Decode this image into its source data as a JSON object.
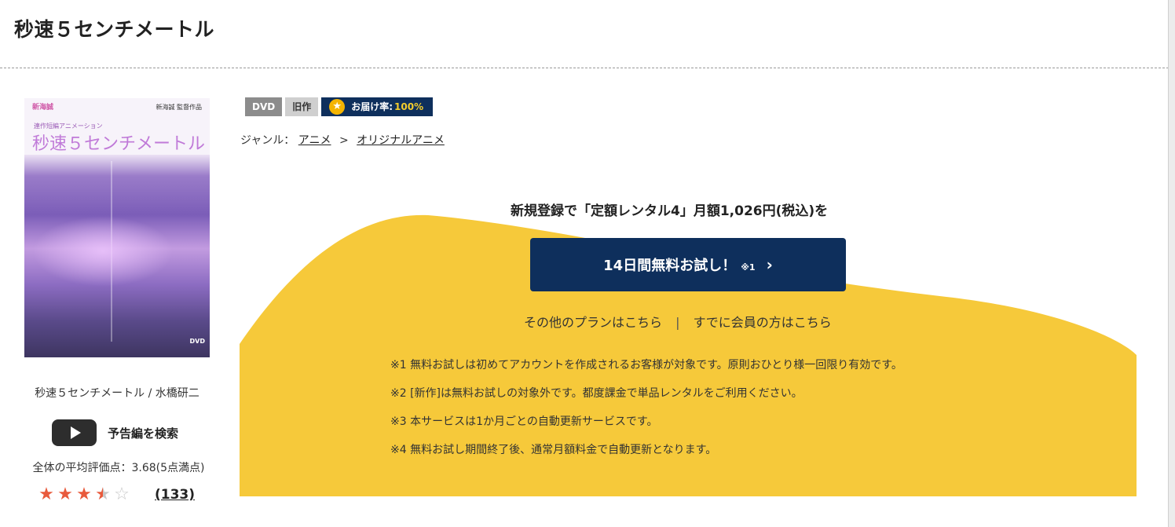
{
  "page": {
    "title": "秒速５センチメートル"
  },
  "cover": {
    "logo_text": "新海誠",
    "studio_text": "新海誠 監督作品",
    "subtitle_text": "連作短編アニメーション",
    "title_text": "秒速５センチメートル",
    "dvd_mark": "DVD"
  },
  "sidebar": {
    "work_meta": "秒速５センチメートル / 水橋研二",
    "trailer_label": "予告編を検索",
    "average_rating_text": "全体の平均評価点：3.68(5点満点)",
    "rating_value": 3.68,
    "rating_max": 5,
    "review_count": "(133)"
  },
  "badges": {
    "format": "DVD",
    "category": "旧作",
    "delivery_label": "お届け率:",
    "delivery_value": "100%"
  },
  "genre": {
    "label": "ジャンル：",
    "primary": "アニメ",
    "separator": ">",
    "secondary": "オリジナルアニメ"
  },
  "promo": {
    "heading": "新規登録で「定額レンタル4」月額1,026円(税込)を",
    "cta_label": "14日間無料お試し！",
    "cta_note": "※1",
    "cta_chevron": "›",
    "other_plans_link": "その他のプランはこちら",
    "links_separator": "|",
    "member_link": "すでに会員の方はこちら",
    "notes": [
      "※1 無料お試しは初めてアカウントを作成されるお客様が対象です。原則おひとり様一回限り有効です。",
      "※2 [新作]は無料お試しの対象外です。都度課金で単品レンタルをご利用ください。",
      "※3 本サービスは1か月ごとの自動更新サービスです。",
      "※4 無料お試し期間終了後、通常月額料金で自動更新となります。"
    ]
  },
  "colors": {
    "accent_navy": "#0e2f5c",
    "promo_yellow": "#f6c93a",
    "star_red": "#e85a3c",
    "rate_yellow": "#f5cd2c"
  }
}
